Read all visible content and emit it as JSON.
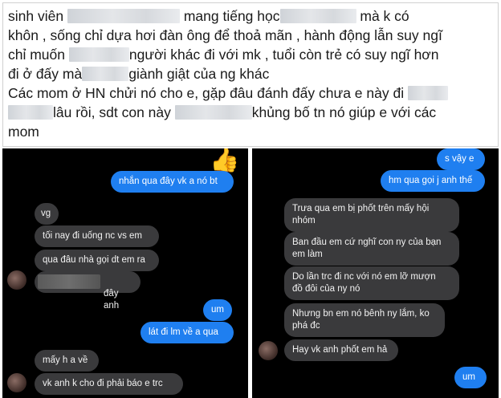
{
  "caption": {
    "line1_a": "sinh viên",
    "line1_b": "mang tiếng học",
    "line1_c": "mà k có",
    "line2": "khôn , sống chỉ dựa hơi đàn ông để thoả mãn , hành động lẫn suy ngĩ",
    "line3_a": "chỉ muốn",
    "line3_b": "người khác đi với mk , tuổi còn trẻ có suy ngĩ hơn",
    "line4_a": "đi ở đấy mà",
    "line4_b": "giành giật của ng khác",
    "line5_a": "Các mom ở HN chửi nó cho e, gặp đâu đánh đấy chưa e này đi",
    "line6_a": "lâu rồi, sdt con này",
    "line6_b": "khủng bố tn nó giúp e với các",
    "line7": "mom"
  },
  "left_chat": {
    "thumb_icon": "thumbs-up-icon",
    "messages": [
      {
        "id": "l1",
        "dir": "sent",
        "text": "nhắn qua đây vk a nó bt"
      },
      {
        "id": "l2",
        "dir": "recv",
        "text": "vg"
      },
      {
        "id": "l3",
        "dir": "recv",
        "text": "tối nay đi uống nc vs em"
      },
      {
        "id": "l4",
        "dir": "recv",
        "text": "qua đâu nhà gọi dt em ra"
      },
      {
        "id": "l5",
        "dir": "recv",
        "text": "đây anh"
      },
      {
        "id": "l6",
        "dir": "sent",
        "text": "um"
      },
      {
        "id": "l7",
        "dir": "sent",
        "text": "lát đi lm về a qua"
      },
      {
        "id": "l8",
        "dir": "recv",
        "text": "mấy h a về"
      },
      {
        "id": "l9",
        "dir": "recv",
        "text": "vk anh k cho đi phải báo e trc"
      }
    ]
  },
  "right_chat": {
    "messages": [
      {
        "id": "r1",
        "dir": "sent",
        "text": "s vậy e"
      },
      {
        "id": "r2",
        "dir": "sent",
        "text": "hm qua gọi j anh thế"
      },
      {
        "id": "r3",
        "dir": "recv",
        "text": "Trưa qua em bị phốt trên mấy hội\nnhóm"
      },
      {
        "id": "r4",
        "dir": "recv",
        "text": "Ban đầu em cứ nghĩ con ny của bạn\nem làm"
      },
      {
        "id": "r5",
        "dir": "recv",
        "text": "Do lần trc đi nc với nó em lỡ mượn\nđồ đôi của ny nó"
      },
      {
        "id": "r6",
        "dir": "recv",
        "text": "Nhưng bn em nó bênh ny lắm, ko\nphá đc"
      },
      {
        "id": "r7",
        "dir": "recv",
        "text": "Hay vk anh phốt em hả"
      },
      {
        "id": "r8",
        "dir": "sent",
        "text": "um"
      }
    ]
  }
}
